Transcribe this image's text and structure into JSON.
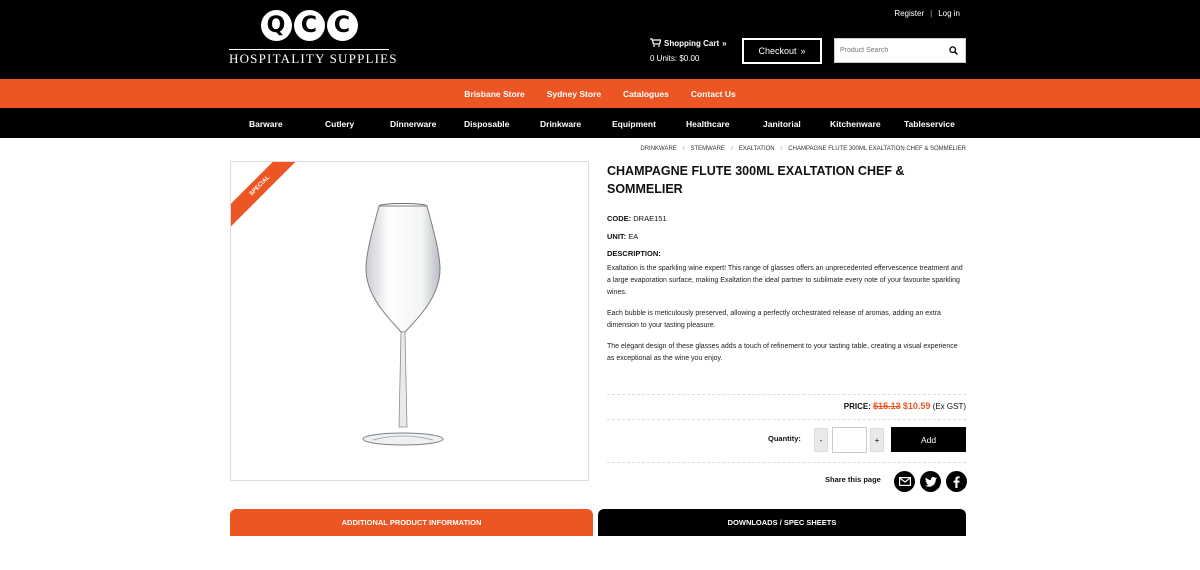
{
  "brand": {
    "logo_letters": [
      "Q",
      "C",
      "C"
    ],
    "tagline": "HOSPITALITY SUPPLIES"
  },
  "header": {
    "register_label": "Register",
    "separator": "|",
    "login_label": "Log in",
    "cart_title": "Shopping Cart",
    "cart_summary": "0 Units: $0.00",
    "checkout_label": "Checkout",
    "search_placeholder": "Product Search"
  },
  "store_nav": [
    "Brisbane Store",
    "Sydney Store",
    "Catalogues",
    "Contact Us"
  ],
  "category_nav": [
    "Barware",
    "Cutlery",
    "Dinnerware",
    "Disposable",
    "Drinkware",
    "Equipment",
    "Healthcare",
    "Janitorial",
    "Kitchenware",
    "Tableservice"
  ],
  "breadcrumb": [
    "DRINKWARE",
    "STEMWARE",
    "EXALTATION",
    "CHAMPAGNE FLUTE 300ML EXALTATION CHEF & SOMMELIER"
  ],
  "product": {
    "ribbon": "SPECIAL",
    "title": "CHAMPAGNE FLUTE 300ML EXALTATION CHEF & SOMMELIER",
    "code_label": "CODE:",
    "code": "DRAE151",
    "unit_label": "UNIT:",
    "unit": "EA",
    "description_label": "DESCRIPTION:",
    "description": [
      "Exaltation is the sparkling wine expert! This range of glasses offers an unprecedented effervescence treatment and a large evaporation surface, making Exaltation the ideal partner to sublimate every note of your favourite sparkling wines.",
      "Each bubble is meticulously preserved, allowing a perfectly orchestrated release of aromas, adding an extra dimension to your tasting pleasure.",
      "The elegant design of these glasses adds a touch of refinement to your tasting table, creating a visual experience as exceptional as the wine you enjoy."
    ],
    "price_label": "PRICE:",
    "old_price": "$15.13",
    "new_price": "$10.59",
    "tax_note": "(Ex GST)",
    "quantity_label": "Quantity:",
    "minus_label": "-",
    "plus_label": "+",
    "quantity_value": "",
    "add_label": "Add",
    "share_label": "Share this page"
  },
  "tabs": {
    "info": "ADDITIONAL PRODUCT INFORMATION",
    "downloads": "DOWNLOADS / SPEC SHEETS"
  },
  "colors": {
    "accent": "#ec5624",
    "dark": "#000000"
  }
}
